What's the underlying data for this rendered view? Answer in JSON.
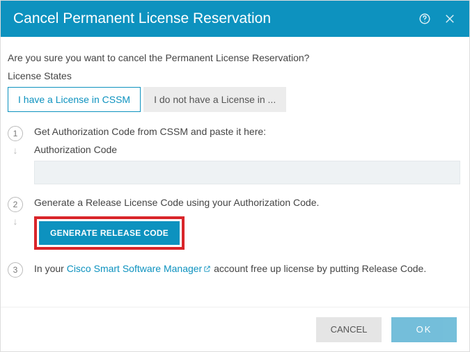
{
  "header": {
    "title": "Cancel Permanent License Reservation"
  },
  "confirm_text": "Are you sure you want to cancel the Permanent License Reservation?",
  "states_label": "License States",
  "tabs": {
    "active": "I have a License in CSSM",
    "inactive": "I do not have a License in ..."
  },
  "step1": {
    "instruction": "Get Authorization Code from CSSM and paste it here:",
    "field_label": "Authorization Code",
    "value": ""
  },
  "step2": {
    "instruction": "Generate a Release License Code using your Authorization Code.",
    "button": "GENERATE RELEASE CODE"
  },
  "step3": {
    "prefix": "In your ",
    "link_text": "Cisco Smart Software Manager",
    "suffix": " account free up license by putting Release Code."
  },
  "footer": {
    "cancel": "CANCEL",
    "ok": "OK"
  }
}
